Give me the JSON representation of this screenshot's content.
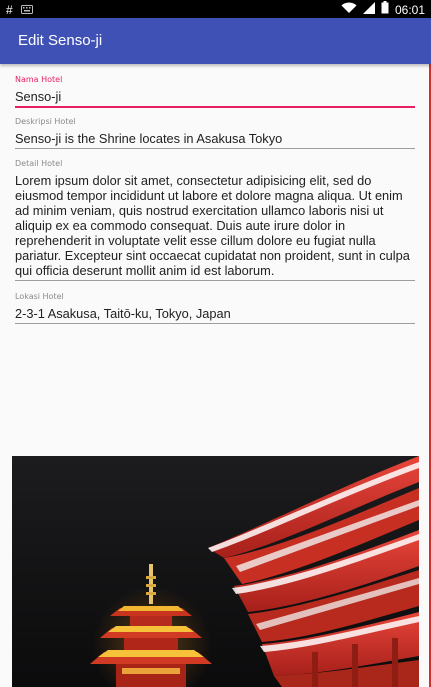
{
  "status_bar": {
    "time": "06:01",
    "left_icons": [
      "hash-icon",
      "keyboard-icon"
    ],
    "right_icons": [
      "wifi-icon",
      "signal-icon",
      "battery-icon"
    ]
  },
  "app_bar": {
    "title": "Edit Senso-ji"
  },
  "form": {
    "nama_hotel": {
      "label": "Nama Hotel",
      "value": "Senso-ji"
    },
    "deskripsi_hotel": {
      "label": "Deskripsi Hotel",
      "value": "Senso-ji is the Shrine locates in Asakusa Tokyo"
    },
    "detail_hotel": {
      "label": "Detail Hotel",
      "value": "Lorem ipsum dolor sit amet, consectetur adipisicing elit, sed do eiusmod tempor incididunt ut labore et dolore magna aliqua. Ut enim ad minim veniam, quis nostrud exercitation ullamco laboris nisi ut aliquip ex ea commodo consequat. Duis aute irure dolor in reprehenderit in voluptate velit esse cillum dolore eu fugiat nulla pariatur. Excepteur sint occaecat cupidatat non proident, sunt in culpa qui officia deserunt mollit anim id est laborum."
    },
    "lokasi_hotel": {
      "label": "Lokasi Hotel",
      "value": "2-3-1 Asakusa, Taitō-ku, Tokyo, Japan"
    }
  },
  "photo": {
    "subject": "senso-ji-pagoda-night-photo"
  },
  "colors": {
    "primary": "#3f51b5",
    "accent": "#e91e63",
    "status_bar": "#000000"
  }
}
